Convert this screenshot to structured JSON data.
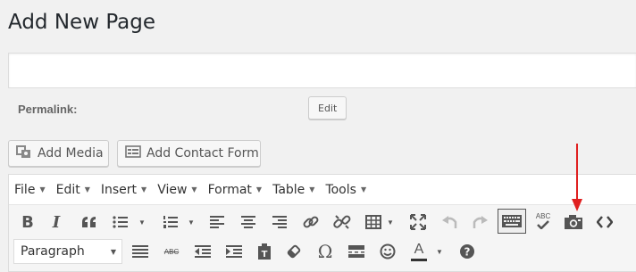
{
  "page": {
    "title": "Add New Page"
  },
  "title_field": {
    "value": "",
    "placeholder": ""
  },
  "permalink": {
    "label": "Permalink:",
    "edit_label": "Edit"
  },
  "media_buttons": {
    "add_media": "Add Media",
    "add_contact_form": "Add Contact Form"
  },
  "menubar": {
    "items": [
      {
        "label": "File"
      },
      {
        "label": "Edit"
      },
      {
        "label": "Insert"
      },
      {
        "label": "View"
      },
      {
        "label": "Format"
      },
      {
        "label": "Table"
      },
      {
        "label": "Tools"
      }
    ]
  },
  "toolbar1": [
    "bold-icon",
    "italic-icon",
    "blockquote-icon",
    "bullet-list-icon",
    "numbered-list-icon",
    "align-left-icon",
    "align-center-icon",
    "align-right-icon",
    "link-icon",
    "unlink-icon",
    "table-icon",
    "fullscreen-icon",
    "undo-icon",
    "redo-icon",
    "keyboard-icon",
    "spellcheck-icon",
    "camera-icon",
    "code-icon"
  ],
  "toolbar1_text": {
    "bold": "B",
    "italic": "I",
    "spellcheck": "ABC"
  },
  "toolbar2": {
    "format_select": {
      "selected": "Paragraph"
    },
    "icons": [
      "horizontal-rule-icon",
      "strikethrough-icon",
      "outdent-icon",
      "indent-icon",
      "paste-text-icon",
      "clear-formatting-icon",
      "omega-icon",
      "page-break-icon",
      "smiley-icon",
      "text-color-icon",
      "help-icon"
    ],
    "strikethrough_text": "ABC",
    "omega_text": "Ω",
    "text_color_text": "A",
    "help_text": "?"
  },
  "colors": {
    "annotation_arrow": "#e02020",
    "background": "#f1f1f1"
  }
}
